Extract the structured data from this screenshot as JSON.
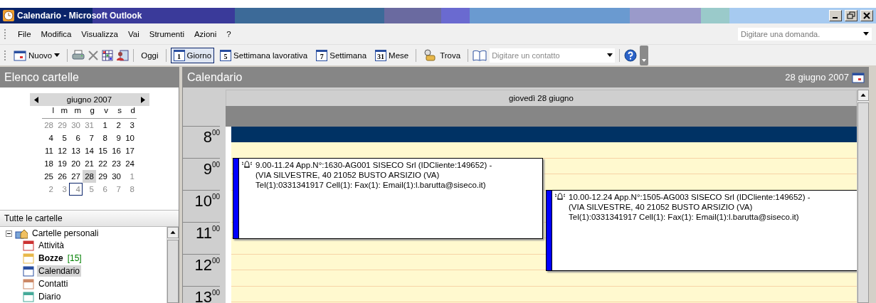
{
  "window": {
    "title": "Calendario - Microsoft Outlook"
  },
  "menu": {
    "items": [
      "File",
      "Modifica",
      "Visualizza",
      "Vai",
      "Strumenti",
      "Azioni",
      "?"
    ],
    "ask_placeholder": "Digitare una domanda."
  },
  "toolbar": {
    "groups": [
      [
        {
          "kind": "button",
          "label": "Nuovo",
          "dropdown": true
        }
      ],
      [
        {
          "kind": "icon"
        },
        {
          "kind": "icon"
        },
        {
          "kind": "icon"
        },
        {
          "kind": "icon"
        }
      ],
      [
        {
          "kind": "text",
          "label": "Oggi"
        }
      ],
      [
        {
          "kind": "view",
          "badge": "1",
          "label": "Giorno",
          "selected": true
        },
        {
          "kind": "view",
          "badge": "5",
          "label": "Settimana lavorativa",
          "selected": false
        },
        {
          "kind": "view",
          "badge": "7",
          "label": "Settimana",
          "selected": false
        },
        {
          "kind": "view",
          "badge": "31",
          "label": "Mese",
          "selected": false
        }
      ],
      [
        {
          "kind": "button",
          "label": "Trova",
          "dropdown": false
        }
      ],
      [
        {
          "kind": "icon"
        },
        {
          "kind": "field",
          "placeholder": "Digitare un contatto"
        }
      ],
      [
        {
          "kind": "icon"
        }
      ]
    ]
  },
  "folder_pane": {
    "title": "Elenco cartelle",
    "mini_calendar": {
      "month": "giugno 2007",
      "weekdays": [
        "l",
        "m",
        "m",
        "g",
        "v",
        "s",
        "d"
      ],
      "weeks": [
        [
          {
            "d": "28",
            "muted": true,
            "selected": false,
            "today": false
          },
          {
            "d": "29",
            "muted": true,
            "selected": false,
            "today": false
          },
          {
            "d": "30",
            "muted": true,
            "selected": false,
            "today": false
          },
          {
            "d": "31",
            "muted": true,
            "selected": false,
            "today": false
          },
          {
            "d": "1",
            "muted": false,
            "selected": false,
            "today": false
          },
          {
            "d": "2",
            "muted": false,
            "selected": false,
            "today": false
          },
          {
            "d": "3",
            "muted": false,
            "selected": false,
            "today": false
          }
        ],
        [
          {
            "d": "4",
            "muted": false,
            "selected": false,
            "today": false
          },
          {
            "d": "5",
            "muted": false,
            "selected": false,
            "today": false
          },
          {
            "d": "6",
            "muted": false,
            "selected": false,
            "today": false
          },
          {
            "d": "7",
            "muted": false,
            "selected": false,
            "today": false
          },
          {
            "d": "8",
            "muted": false,
            "selected": false,
            "today": false
          },
          {
            "d": "9",
            "muted": false,
            "selected": false,
            "today": false
          },
          {
            "d": "10",
            "muted": false,
            "selected": false,
            "today": false
          }
        ],
        [
          {
            "d": "11",
            "muted": false,
            "selected": false,
            "today": false
          },
          {
            "d": "12",
            "muted": false,
            "selected": false,
            "today": false
          },
          {
            "d": "13",
            "muted": false,
            "selected": false,
            "today": false
          },
          {
            "d": "14",
            "muted": false,
            "selected": false,
            "today": false
          },
          {
            "d": "15",
            "muted": false,
            "selected": false,
            "today": false
          },
          {
            "d": "16",
            "muted": false,
            "selected": false,
            "today": false
          },
          {
            "d": "17",
            "muted": false,
            "selected": false,
            "today": false
          }
        ],
        [
          {
            "d": "18",
            "muted": false,
            "selected": false,
            "today": false
          },
          {
            "d": "19",
            "muted": false,
            "selected": false,
            "today": false
          },
          {
            "d": "20",
            "muted": false,
            "selected": false,
            "today": false
          },
          {
            "d": "21",
            "muted": false,
            "selected": false,
            "today": false
          },
          {
            "d": "22",
            "muted": false,
            "selected": false,
            "today": false
          },
          {
            "d": "23",
            "muted": false,
            "selected": false,
            "today": false
          },
          {
            "d": "24",
            "muted": false,
            "selected": false,
            "today": false
          }
        ],
        [
          {
            "d": "25",
            "muted": false,
            "selected": false,
            "today": false
          },
          {
            "d": "26",
            "muted": false,
            "selected": false,
            "today": false
          },
          {
            "d": "27",
            "muted": false,
            "selected": false,
            "today": false
          },
          {
            "d": "28",
            "muted": false,
            "selected": true,
            "today": false
          },
          {
            "d": "29",
            "muted": false,
            "selected": false,
            "today": false
          },
          {
            "d": "30",
            "muted": false,
            "selected": false,
            "today": false
          },
          {
            "d": "1",
            "muted": true,
            "selected": false,
            "today": false
          }
        ],
        [
          {
            "d": "2",
            "muted": true,
            "selected": false,
            "today": false
          },
          {
            "d": "3",
            "muted": true,
            "selected": false,
            "today": false
          },
          {
            "d": "4",
            "muted": true,
            "selected": false,
            "today": true
          },
          {
            "d": "5",
            "muted": true,
            "selected": false,
            "today": false
          },
          {
            "d": "6",
            "muted": true,
            "selected": false,
            "today": false
          },
          {
            "d": "7",
            "muted": true,
            "selected": false,
            "today": false
          },
          {
            "d": "8",
            "muted": true,
            "selected": false,
            "today": false
          }
        ]
      ]
    },
    "section": "Tutte le cartelle",
    "tree": [
      {
        "label": "Cartelle personali",
        "expanded": true,
        "selected": false,
        "children": [
          {
            "label": "Attività",
            "selected": false
          },
          {
            "label": "Bozze",
            "count": "[15]",
            "selected": false
          },
          {
            "label": "Calendario",
            "selected": true
          },
          {
            "label": "Contatti",
            "selected": false
          },
          {
            "label": "Diario",
            "selected": false
          }
        ]
      }
    ]
  },
  "calendar": {
    "title": "Calendario",
    "date": "28 giugno 2007",
    "day_header": "giovedì 28 giugno",
    "hours": [
      "8$^{00}$",
      "9$^{00}$",
      "10$^{00}$",
      "11$^{00}$",
      "12$^{00}$",
      "13$^{00}$"
    ],
    "appointments": [
      {
        "reminder": true,
        "lines": [
          "9.00-11.24 App.N°:1630-AG001 SISECO Srl (IDCliente:149652) -",
          "(VIA SILVESTRE, 40 21052 BUSTO ARSIZIO (VA)",
          "Tel(1):0331341917 Cell(1): Fax(1): Email(1):l.barutta@siseco.it)"
        ]
      },
      {
        "reminder": true,
        "lines": [
          "10.00-12.24 App.N°:1505-AG003 SISECO Srl (IDCliente:149652) -",
          "(VIA SILVESTRE, 40 21052 BUSTO ARSIZIO (VA)",
          "Tel(1):0331341917 Cell(1): Fax(1): Email(1):l.barutta@siseco.it)"
        ]
      }
    ]
  }
}
